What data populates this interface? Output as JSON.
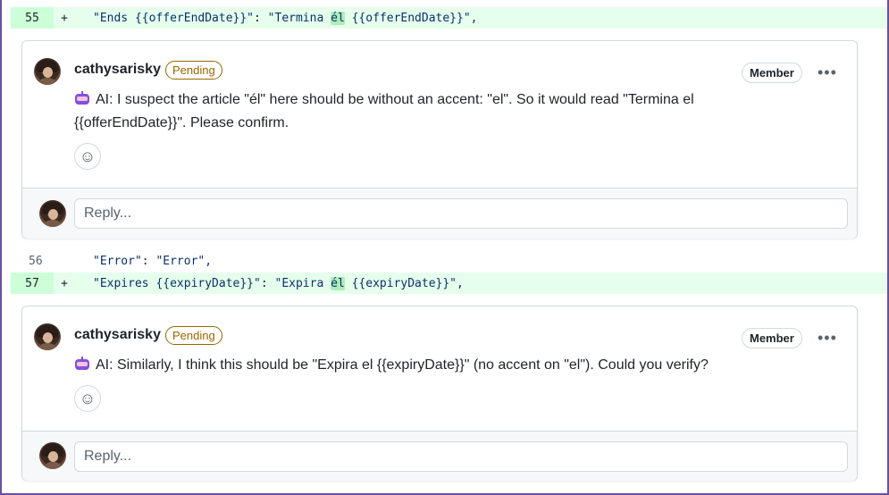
{
  "lines": [
    {
      "number": "55",
      "sign": "+",
      "key": "\"Ends {{offerEndDate}}\"",
      "sep": ": ",
      "value_pre": "\"Termina ",
      "value_hl": "él",
      "value_post": " {{offerEndDate}}\",",
      "type": "added"
    },
    {
      "number": "56",
      "sign": "",
      "key": "\"Error\"",
      "sep": ": ",
      "value_pre": "\"Error\",",
      "value_hl": "",
      "value_post": "",
      "type": "context"
    },
    {
      "number": "57",
      "sign": "+",
      "key": "\"Expires {{expiryDate}}\"",
      "sep": ": ",
      "value_pre": "\"Expira ",
      "value_hl": "él",
      "value_post": " {{expiryDate}}\",",
      "type": "added"
    }
  ],
  "comments": [
    {
      "author": "cathysarisky",
      "status": "Pending",
      "role": "Member",
      "menu": "•••",
      "message_line1": "AI: I suspect the article \"él\" here should be without an accent: \"el\". So it would read \"Termina el",
      "message_line2": "{{offerEndDate}}\". Please confirm.",
      "reaction_icon": "smiley-icon",
      "reply_placeholder": "Reply..."
    },
    {
      "author": "cathysarisky",
      "status": "Pending",
      "role": "Member",
      "menu": "•••",
      "message_line1": "AI: Similarly, I think this should be \"Expira el {{expiryDate}}\" (no accent on \"el\"). Could you verify?",
      "message_line2": "",
      "reaction_icon": "smiley-icon",
      "reply_placeholder": "Reply..."
    }
  ],
  "colors": {
    "added_bg": "#e6ffec",
    "added_num_bg": "#ccffd8",
    "highlight": "#aceebb",
    "pending": "#9a6700",
    "frame": "#6a4fa0"
  }
}
